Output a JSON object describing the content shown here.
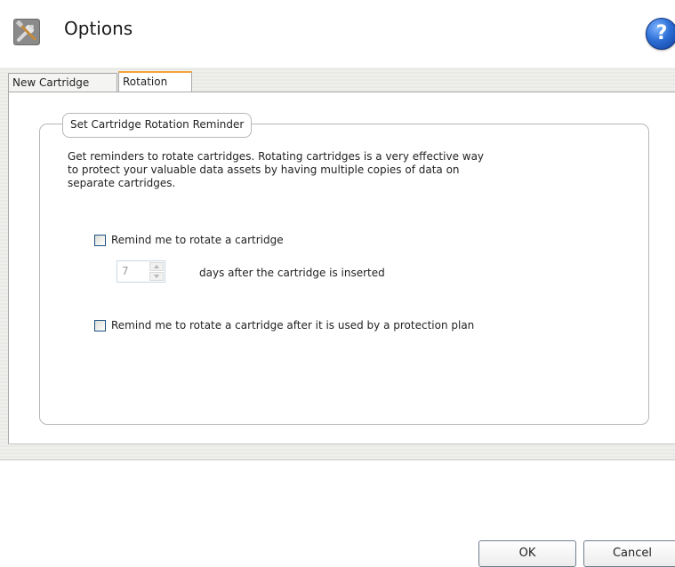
{
  "window": {
    "title": "Options",
    "icons": {
      "app": "tools-icon",
      "help": "help-icon"
    },
    "help_glyph": "?"
  },
  "tabs": [
    {
      "label": "New Cartridge",
      "active": false
    },
    {
      "label": "Rotation",
      "active": true
    }
  ],
  "rotation": {
    "group_title": "Set Cartridge Rotation Reminder",
    "description": "Get reminders to rotate cartridges. Rotating cartridges is a very effective way\nto protect your valuable data assets by having multiple copies of data on\nseparate cartridges.",
    "remind_days": {
      "label": "Remind me to rotate a cartridge",
      "checked": false,
      "days_value": "7",
      "days_suffix": "days after the cartridge is inserted"
    },
    "remind_plan": {
      "label": "Remind me to rotate a cartridge after it is used by a protection plan",
      "checked": false
    }
  },
  "footer": {
    "ok_label": "OK",
    "cancel_label": "Cancel"
  },
  "colors": {
    "active_tab_accent": "#f3a53b",
    "checkbox_border": "#1c5180",
    "help_blue": "#2d6fd6"
  }
}
